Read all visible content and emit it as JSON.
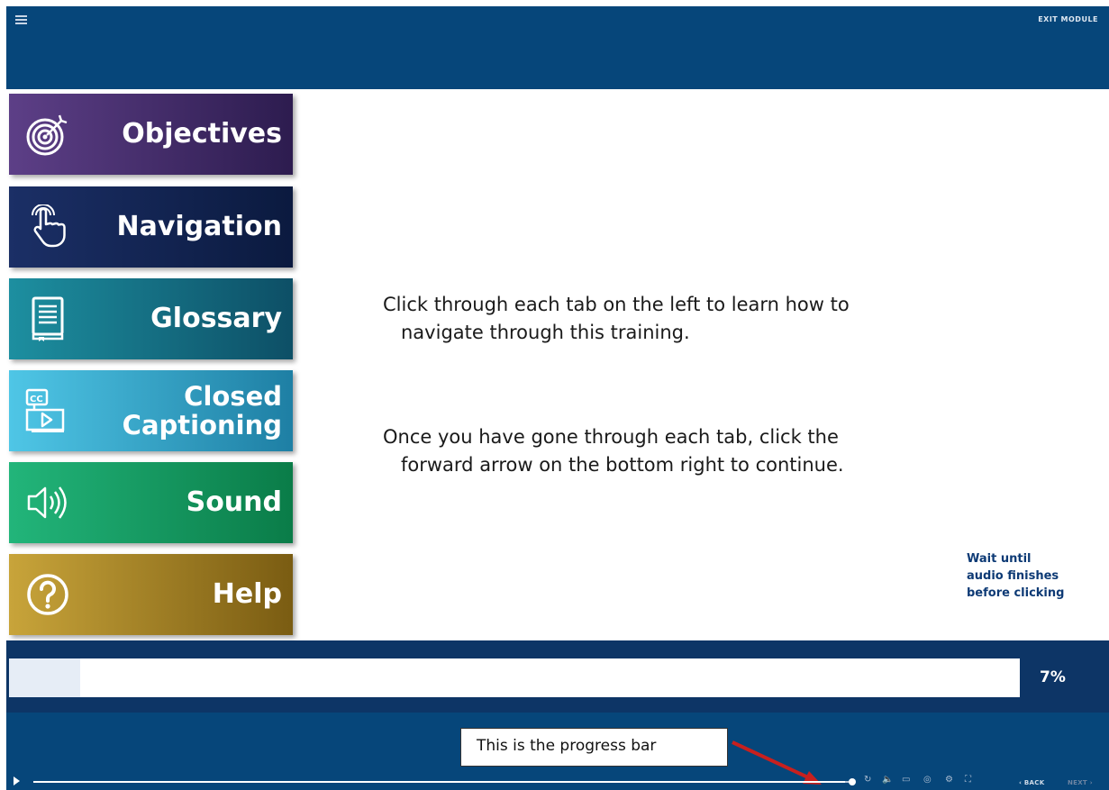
{
  "header": {
    "exit_label": "EXIT MODULE"
  },
  "tabs": [
    {
      "id": "objectives",
      "label": "Objectives",
      "icon": "target-icon",
      "color": "#4b2f78"
    },
    {
      "id": "navigation",
      "label": "Navigation",
      "icon": "hand-pointer-icon",
      "color": "#13254f"
    },
    {
      "id": "glossary",
      "label": "Glossary",
      "icon": "book-icon",
      "color": "#166c82"
    },
    {
      "id": "closed-captioning",
      "label_line1": "Closed",
      "label_line2": "Captioning",
      "icon": "closed-caption-video-icon",
      "color": "#37a8cf"
    },
    {
      "id": "sound",
      "label": "Sound",
      "icon": "speaker-icon",
      "color": "#169a5f"
    },
    {
      "id": "help",
      "label": "Help",
      "icon": "question-circle-icon",
      "color": "#a3821f"
    }
  ],
  "main": {
    "instruction_1_line1": "Click through each tab on the left to learn how to",
    "instruction_1_line2": "navigate through this training.",
    "instruction_2_line1": "Once you have gone through each tab, click the",
    "instruction_2_line2": "forward arrow on the bottom right to continue.",
    "wait_line1": "Wait until",
    "wait_line2": "audio finishes",
    "wait_line3": "before clicking"
  },
  "progress": {
    "percent_label": "7%",
    "value": 0.07
  },
  "callout": {
    "text": "This is the progress bar"
  },
  "playback": {
    "position": 0.99,
    "back_label": "‹ BACK",
    "next_label": "NEXT ›"
  },
  "colors": {
    "header_bg": "#06467a",
    "progress_strip_bg": "#0d3566",
    "wait_text": "#0d3a75",
    "callout_arrow": "#c8201e"
  }
}
